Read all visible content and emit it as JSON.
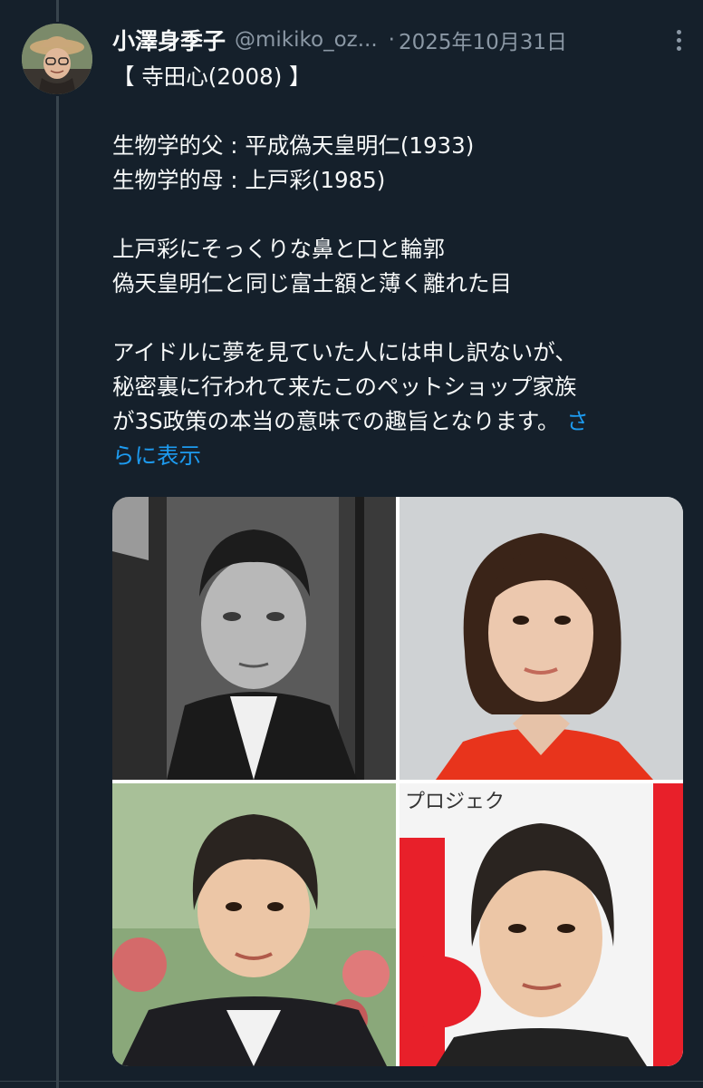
{
  "tweet": {
    "display_name": "小澤身季子",
    "handle": "@mikiko_oz...",
    "separator": "·",
    "timestamp": "2025年10月31日",
    "more_icon": "more-vertical-icon",
    "lines": [
      "【 寺田心(2008) 】",
      "",
      "生物学的父 : 平成偽天皇明仁(1933)",
      "生物学的母 : 上戸彩(1985)",
      "",
      "上戸彩にそっくりな鼻と口と輪郭",
      "偽天皇明仁と同じ富士額と薄く離れた目",
      "",
      "アイドルに夢を見ていた人には申し訳ないが、",
      "秘密裏に行われて来たこのペットショップ家族"
    ],
    "last_line": "が3S政策の本当の意味での趣旨となります。",
    "show_more_part1": "さ",
    "show_more_part2": "らに表示",
    "link_color": "#1d9bf0"
  },
  "media": {
    "photos": [
      {
        "name": "black-white-portrait-young-man"
      },
      {
        "name": "portrait-woman-red-top"
      },
      {
        "name": "portrait-boy-dark-jacket"
      },
      {
        "name": "portrait-boy-event-backdrop",
        "backdrop_text": "プロジェク"
      }
    ]
  }
}
